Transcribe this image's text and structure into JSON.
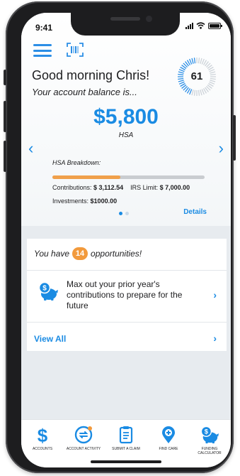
{
  "status_bar": {
    "time": "9:41"
  },
  "header": {
    "greeting": "Good morning Chris!",
    "subtitle": "Your account balance is...",
    "score": "61"
  },
  "balance": {
    "amount": "$5,800",
    "account_type": "HSA",
    "breakdown_title": "HSA Breakdown:",
    "contributions_label": "Contributions:",
    "contributions_value": "$ 3,112.54",
    "irs_limit_label": "IRS Limit:",
    "irs_limit_value": "$ 7,000.00",
    "investments_label": "Investments:",
    "investments_value": "$1000.00",
    "progress_fraction": 0.445,
    "details_label": "Details",
    "carousel_pages": 2,
    "carousel_active": 0
  },
  "opportunities": {
    "prefix": "You have",
    "count": "14",
    "suffix": "opportunities!",
    "item_text": "Max out your prior year's contributions to prepare for the future",
    "view_all_label": "View All"
  },
  "tabbar": {
    "tabs": [
      {
        "label": "ACCOUNTS",
        "icon": "dollar-icon"
      },
      {
        "label": "ACCOUNT ACTIVITY",
        "icon": "account-activity-icon"
      },
      {
        "label": "SUBMIT A CLAIM",
        "icon": "clipboard-icon"
      },
      {
        "label": "FIND CARE",
        "icon": "location-plus-icon"
      },
      {
        "label": "FUNDING CALCULATOR",
        "icon": "piggy-bank-icon"
      }
    ]
  },
  "colors": {
    "accent": "#1a8be3",
    "badge": "#f29a3c",
    "progress": "#f0a04b"
  }
}
